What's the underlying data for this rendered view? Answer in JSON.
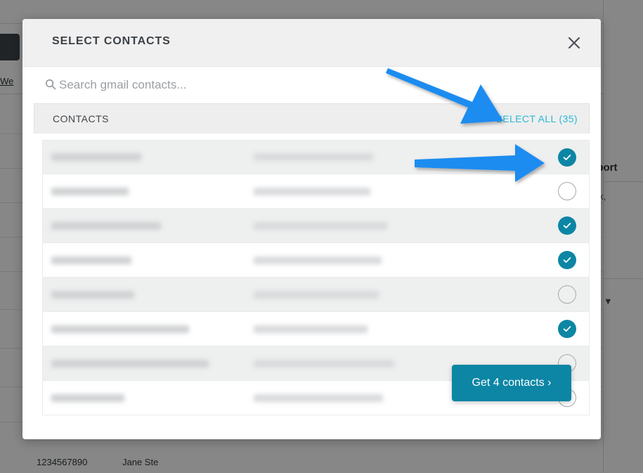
{
  "modal": {
    "title": "SELECT CONTACTS",
    "close_icon": "close-icon",
    "search": {
      "icon": "search-icon",
      "placeholder": "Search gmail contacts...",
      "value": ""
    },
    "list_header": {
      "label": "CONTACTS",
      "select_all_label": "SELECT ALL (35)",
      "select_all_count": 35
    },
    "rows": [
      {
        "name": "",
        "email": "",
        "checked": true,
        "redacted": true,
        "name_width": 128,
        "email_width": 170
      },
      {
        "name": "",
        "email": "",
        "checked": false,
        "redacted": true,
        "name_width": 110,
        "email_width": 166
      },
      {
        "name": "",
        "email": "",
        "checked": true,
        "redacted": true,
        "name_width": 156,
        "email_width": 190
      },
      {
        "name": "",
        "email": "",
        "checked": true,
        "redacted": true,
        "name_width": 114,
        "email_width": 182
      },
      {
        "name": "",
        "email": "",
        "checked": false,
        "redacted": true,
        "name_width": 118,
        "email_width": 178
      },
      {
        "name": "",
        "email": "",
        "checked": true,
        "redacted": true,
        "name_width": 196,
        "email_width": 162
      },
      {
        "name": "",
        "email": "",
        "checked": false,
        "redacted": true,
        "name_width": 224,
        "email_width": 200
      },
      {
        "name": "",
        "email": "",
        "checked": false,
        "redacted": true,
        "name_width": 104,
        "email_width": 184
      }
    ],
    "primary_button": {
      "label": "Get 4 contacts ›",
      "count": 4,
      "color": "#0c86a4"
    },
    "scrollbar": {
      "thumb_position": "near-top"
    }
  },
  "annotations": {
    "color": "#1a8cf0",
    "arrows": [
      {
        "name": "arrow-to-select-all",
        "target": "SELECT ALL (35)"
      },
      {
        "name": "arrow-to-first-checkbox",
        "target": "first contact checkbox"
      }
    ]
  },
  "background": {
    "left_link": "s We",
    "right_panel": {
      "heading": "mport",
      "body": "utlook,",
      "body_line2": ".",
      "dropdown": "TES ▼"
    },
    "bottom_row": {
      "phone": "1234567890",
      "name": "Jane Ste"
    }
  },
  "colors": {
    "accent_teal": "#0c86a4",
    "link_cyan": "#2cb8d6",
    "annotation_blue": "#1a8cf0",
    "header_gray": "#f0f0f0",
    "row_alt": "#eeefef"
  }
}
